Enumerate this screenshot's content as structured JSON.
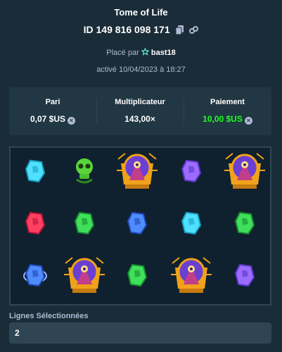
{
  "game": {
    "title": "Tome of Life"
  },
  "bet": {
    "id": "ID 149 816 098 171"
  },
  "placed": {
    "prefix": "Placé par",
    "user": "bast18"
  },
  "date": {
    "text": "activé 10/04/2023 à 18:27"
  },
  "stats": {
    "wager_label": "Pari",
    "wager_value": "0,07 $US",
    "mult_label": "Multiplicateur",
    "mult_value": "143,00×",
    "payout_label": "Paiement",
    "payout_value": "10,00 $US"
  },
  "reels": {
    "cells": [
      {
        "symbol": "cyan-gem-icon"
      },
      {
        "symbol": "green-skull-icon"
      },
      {
        "symbol": "wizard-wild-icon"
      },
      {
        "symbol": "purple-gem-icon"
      },
      {
        "symbol": "wizard-wild-icon"
      },
      {
        "symbol": "red-gem-icon"
      },
      {
        "symbol": "green-gem-icon"
      },
      {
        "symbol": "blue-gem-icon"
      },
      {
        "symbol": "cyan-gem-icon"
      },
      {
        "symbol": "green-gem-icon"
      },
      {
        "symbol": "blue-ring-gem-icon"
      },
      {
        "symbol": "wizard-wild-icon"
      },
      {
        "symbol": "green-gem-icon"
      },
      {
        "symbol": "wizard-wild-icon"
      },
      {
        "symbol": "purple-gem-icon"
      }
    ]
  },
  "lines": {
    "label": "Lignes Sélectionnées",
    "value": "2"
  },
  "colors": {
    "background": "#1a2c38",
    "panel": "#213743",
    "payout": "#1fff20"
  }
}
